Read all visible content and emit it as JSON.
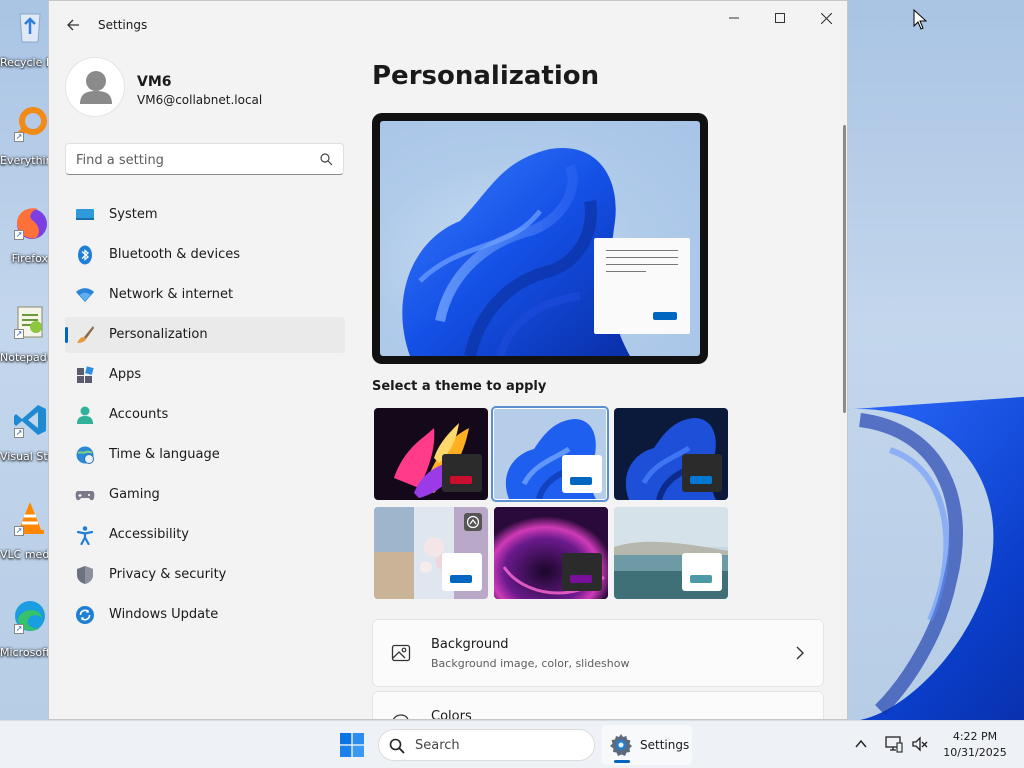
{
  "desktop": {
    "icons": [
      {
        "label": "Recycle Bin"
      },
      {
        "label": "Everything"
      },
      {
        "label": "Firefox"
      },
      {
        "label": "Notepad++"
      },
      {
        "label": "Visual Studio Code"
      },
      {
        "label": "VLC media player"
      },
      {
        "label": "Microsoft Edge"
      }
    ]
  },
  "window": {
    "title": "Settings",
    "controls": [
      "minimize",
      "maximize",
      "close"
    ]
  },
  "profile": {
    "name": "VM6",
    "email": "VM6@collabnet.local"
  },
  "search": {
    "placeholder": "Find a setting"
  },
  "nav": {
    "items": [
      {
        "label": "System",
        "icon": "system-icon"
      },
      {
        "label": "Bluetooth & devices",
        "icon": "bluetooth-icon"
      },
      {
        "label": "Network & internet",
        "icon": "wifi-icon"
      },
      {
        "label": "Personalization",
        "icon": "brush-icon",
        "active": true
      },
      {
        "label": "Apps",
        "icon": "apps-icon"
      },
      {
        "label": "Accounts",
        "icon": "accounts-icon"
      },
      {
        "label": "Time & language",
        "icon": "globe-clock-icon"
      },
      {
        "label": "Gaming",
        "icon": "gamepad-icon"
      },
      {
        "label": "Accessibility",
        "icon": "accessibility-icon"
      },
      {
        "label": "Privacy & security",
        "icon": "shield-icon"
      },
      {
        "label": "Windows Update",
        "icon": "update-icon"
      }
    ]
  },
  "main": {
    "title": "Personalization",
    "theme_section_label": "Select a theme to apply",
    "themes": [
      {
        "name": "glow",
        "accent": "#c8102e"
      },
      {
        "name": "windows-light",
        "accent": "#0067c0",
        "selected": true
      },
      {
        "name": "windows-dark",
        "accent": "#0078d4"
      },
      {
        "name": "captured-motion",
        "accent": "#0067c0"
      },
      {
        "name": "flow",
        "accent": "#7a0f9c"
      },
      {
        "name": "sunrise",
        "accent": "#4d9aa6"
      }
    ],
    "cards": [
      {
        "title": "Background",
        "subtitle": "Background image, color, slideshow",
        "icon": "image-icon"
      },
      {
        "title": "Colors",
        "icon": "palette-icon"
      }
    ]
  },
  "taskbar": {
    "search_label": "Search",
    "app_label": "Settings",
    "time": "4:22 PM",
    "date": "10/31/2025"
  },
  "colors": {
    "accent": "#0067c0",
    "window_bg": "#f3f3f3",
    "taskbar_bg": "#eef1f6"
  }
}
